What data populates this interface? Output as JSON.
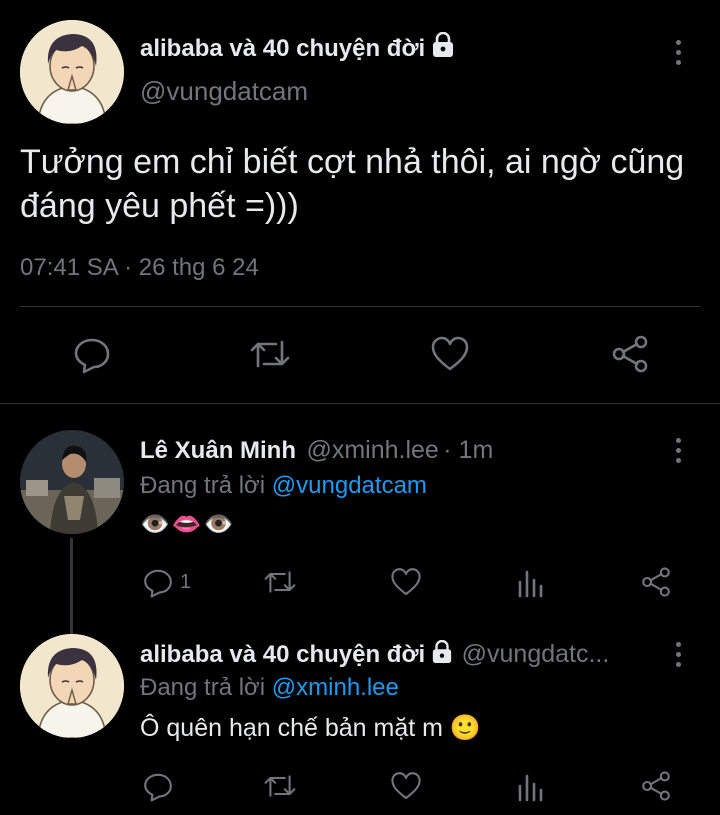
{
  "main_tweet": {
    "author_name": "alibaba và 40 chuyện đời",
    "author_handle": "@vungdatcam",
    "text_line1": "Tưởng em chỉ biết cợt nhả thôi, ai ngờ cũng",
    "text_line2": "đáng yêu phết =)))",
    "timestamp": "07:41 SA · 26 thg 6 24",
    "icons": [
      "reply-icon",
      "retweet-icon",
      "like-icon",
      "share-icon"
    ]
  },
  "replies": [
    {
      "author_name": "Lê Xuân Minh",
      "author_handle": "@xminh.lee",
      "time": "· 1m",
      "replying_prefix": "Đang trả lời",
      "replying_to": "@vungdatcam",
      "text": "👁️👄👁️",
      "reply_count": "1"
    },
    {
      "author_name": "alibaba và 40 chuyện đời",
      "author_handle": "@vungdatc...",
      "replying_prefix": "Đang trả lời",
      "replying_to": "@xminh.lee",
      "text": "Ô quên hạn chế bản mặt m 🙂"
    }
  ],
  "colors": {
    "background": "#000000",
    "text": "#e7e9ea",
    "muted": "#71767b",
    "link": "#1d9bf0",
    "divider": "#2f3336"
  }
}
